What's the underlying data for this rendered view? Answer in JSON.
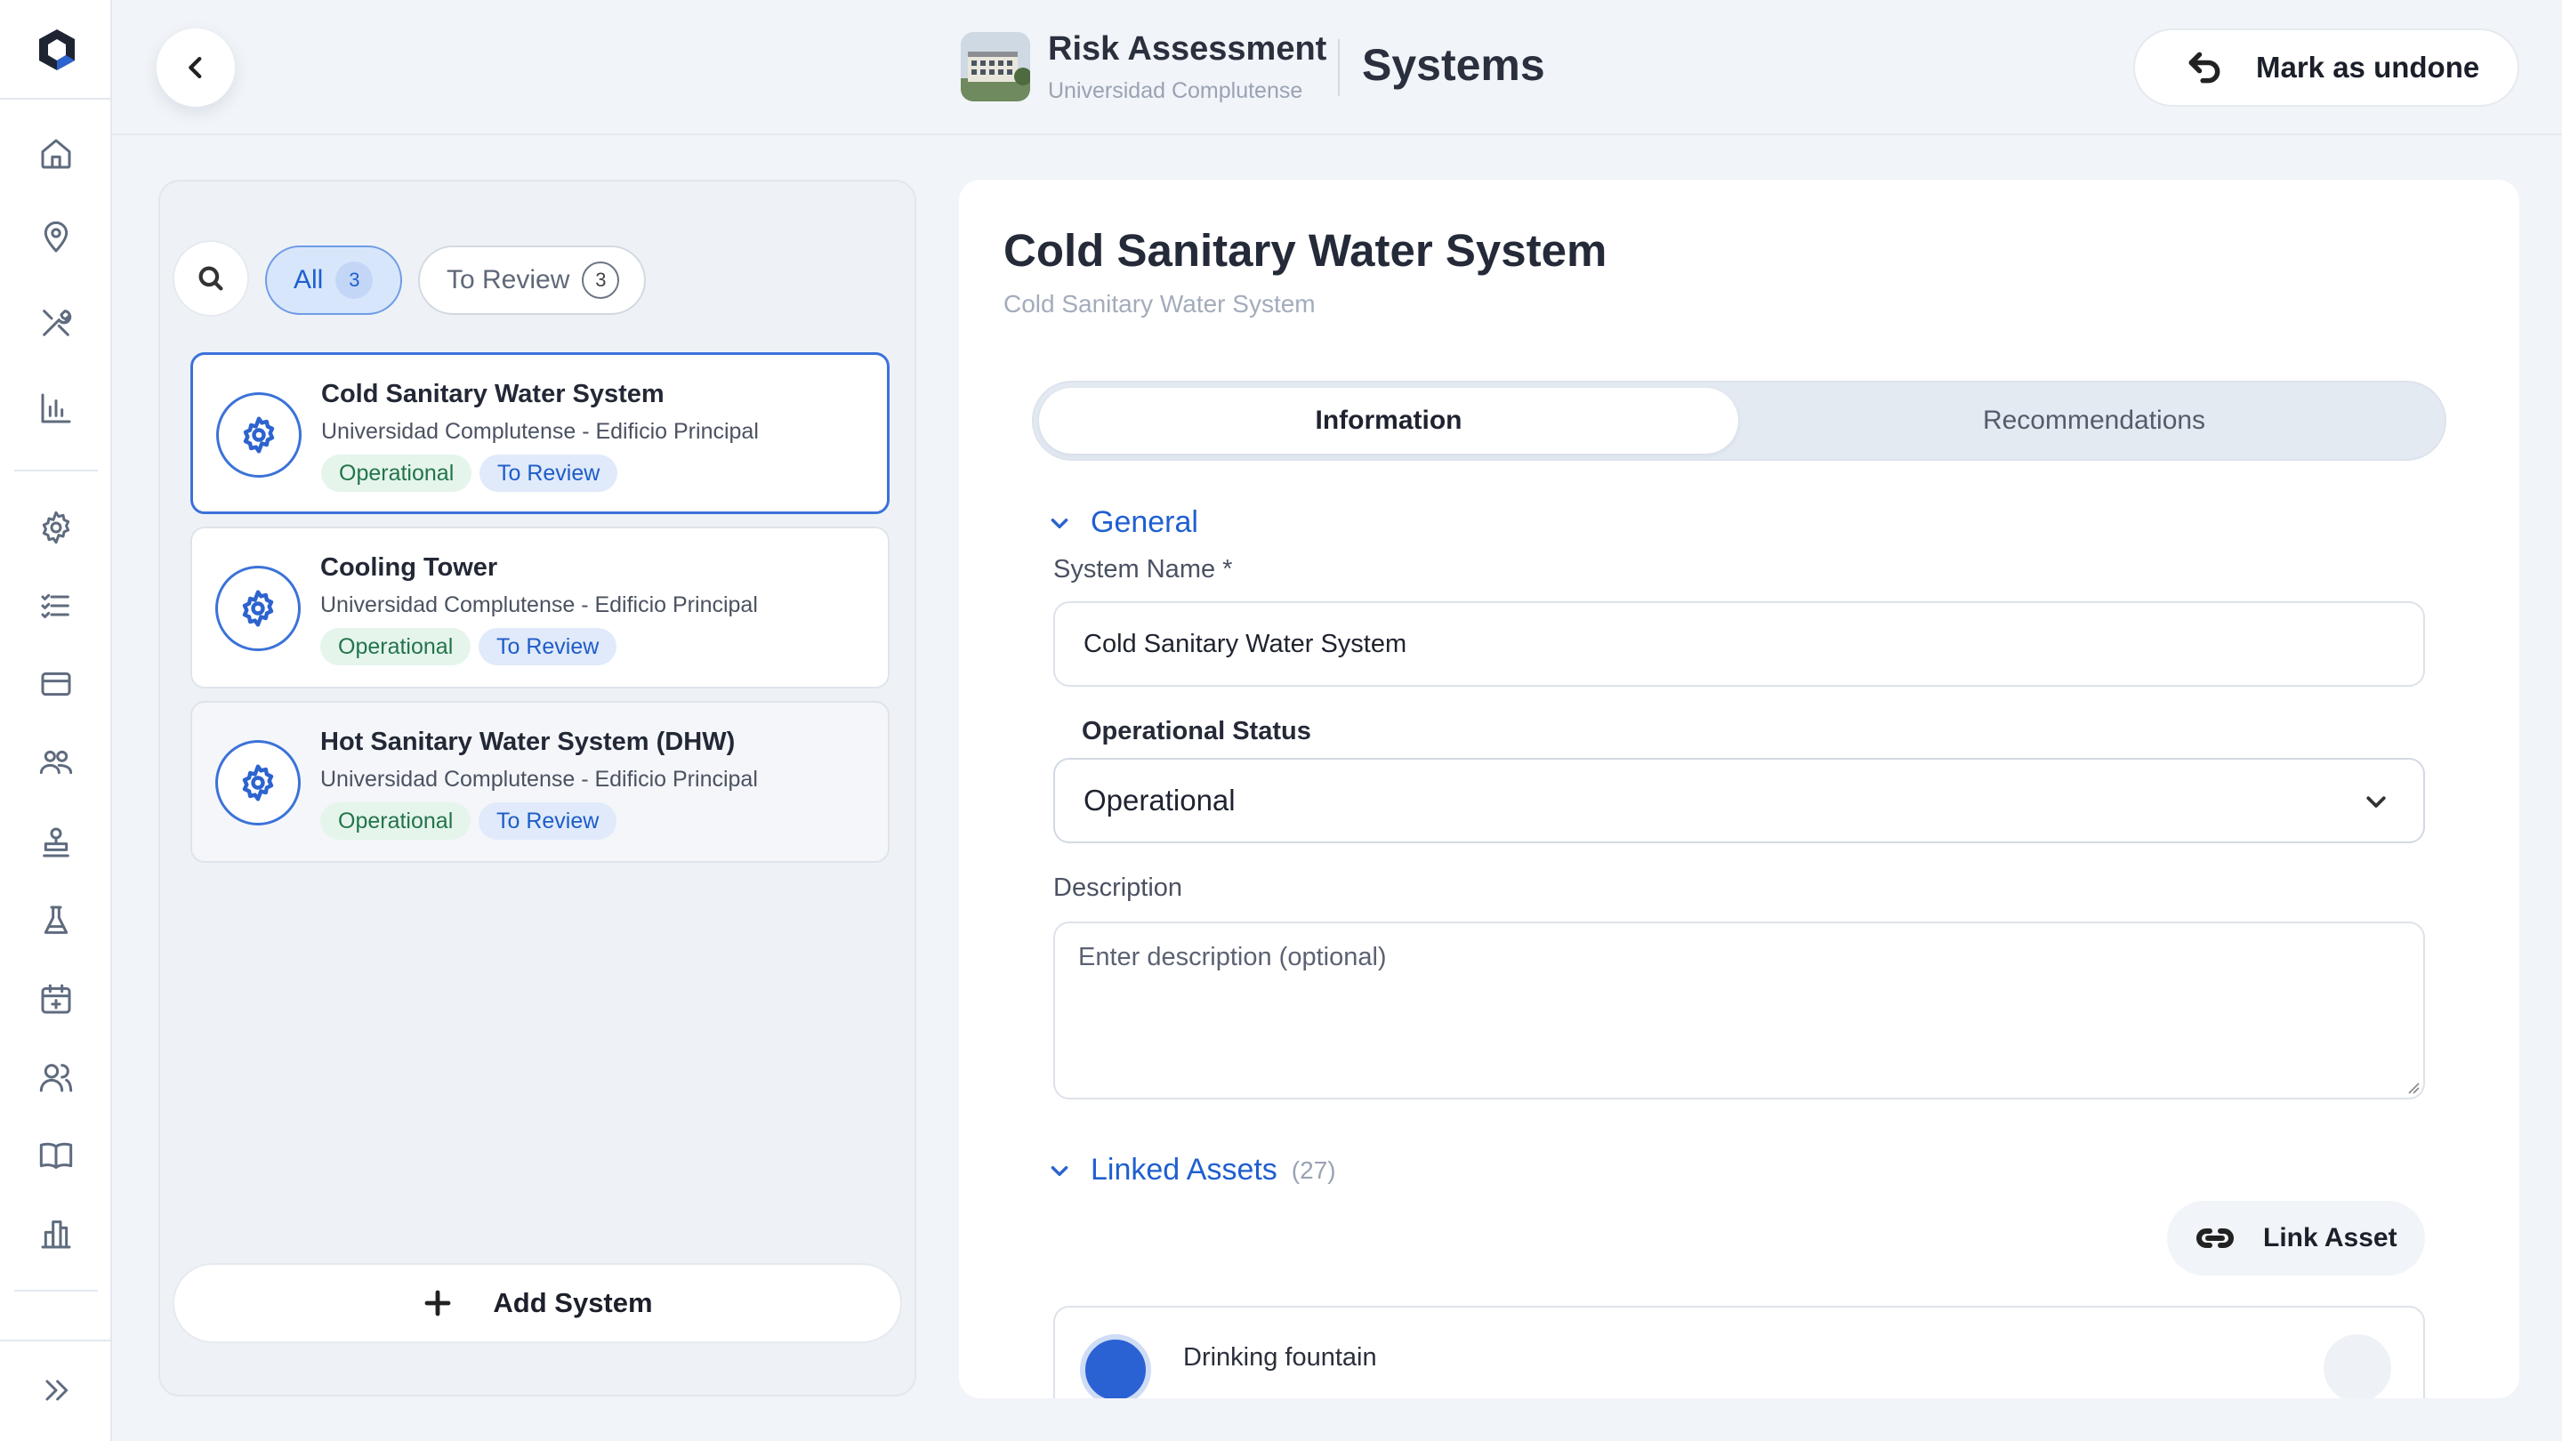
{
  "header": {
    "title": "Risk Assessment",
    "subtitle": "Universidad Complutense",
    "page": "Systems",
    "undone_label": "Mark as undone"
  },
  "filters": {
    "all_label": "All",
    "all_count": "3",
    "review_label": "To Review",
    "review_count": "3"
  },
  "systems": [
    {
      "name": "Cold Sanitary Water System",
      "location": "Universidad Complutense - Edificio Principal",
      "status": "Operational",
      "review": "To Review"
    },
    {
      "name": "Cooling Tower",
      "location": "Universidad Complutense - Edificio Principal",
      "status": "Operational",
      "review": "To Review"
    },
    {
      "name": "Hot Sanitary Water System (DHW)",
      "location": "Universidad Complutense - Edificio Principal",
      "status": "Operational",
      "review": "To Review"
    }
  ],
  "add_label": "Add System",
  "detail": {
    "title": "Cold Sanitary Water System",
    "subtitle": "Cold Sanitary Water System",
    "tabs": [
      "Information",
      "Recommendations"
    ],
    "general_label": "General",
    "system_name_label": "System Name *",
    "system_name_value": "Cold Sanitary Water System",
    "status_label": "Operational Status",
    "status_value": "Operational",
    "description_label": "Description",
    "description_placeholder": "Enter description (optional)",
    "linked_label": "Linked Assets",
    "linked_count": "(27)",
    "link_label": "Link Asset",
    "asset_first": "Drinking fountain"
  },
  "colors": {
    "accent": "#2c63cf",
    "selected_border": "#3b72d9",
    "operational_bg": "#e5f5ec",
    "operational_text": "#23744a",
    "review_bg": "#e0eafb",
    "review_text": "#1d5cc7"
  },
  "icons": {
    "sidebar": [
      "home-icon",
      "location-pin-icon",
      "tools-icon",
      "bar-chart-icon",
      "gear-icon",
      "checklist-icon",
      "card-icon",
      "group-icon",
      "stamp-icon",
      "flask-icon",
      "calendar-icon",
      "users-icon",
      "book-icon",
      "building-icon",
      "expand-icon"
    ]
  }
}
